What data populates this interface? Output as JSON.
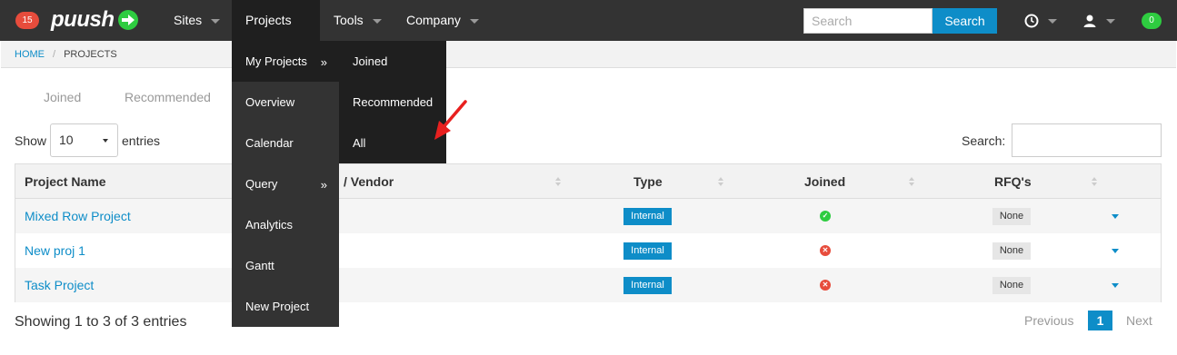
{
  "topbar": {
    "notification_count": "15",
    "logo_text": "puush",
    "nav": [
      {
        "label": "Sites"
      },
      {
        "label": "Projects"
      },
      {
        "label": "Tools"
      },
      {
        "label": "Company"
      }
    ],
    "search_placeholder": "Search",
    "search_button": "Search",
    "message_count": "0"
  },
  "breadcrumb": {
    "home": "HOME",
    "separator": "/",
    "current": "PROJECTS"
  },
  "tabs": [
    {
      "label": "Joined"
    },
    {
      "label": "Recommended"
    }
  ],
  "table_controls": {
    "show_label": "Show",
    "page_size": "10",
    "entries_label": "entries",
    "search_label": "Search:"
  },
  "table": {
    "headers": [
      "Project Name",
      "/ Vendor",
      "Type",
      "Joined",
      "RFQ's"
    ],
    "rows": [
      {
        "name": "Mixed Row Project",
        "type": "Internal",
        "joined": "yes",
        "rfq": "None"
      },
      {
        "name": "New proj 1",
        "type": "Internal",
        "joined": "no",
        "rfq": "None"
      },
      {
        "name": "Task Project",
        "type": "Internal",
        "joined": "no",
        "rfq": "None"
      }
    ]
  },
  "footer": {
    "info": "Showing 1 to 3 of 3 entries",
    "prev": "Previous",
    "page": "1",
    "next": "Next"
  },
  "projects_menu": {
    "items": [
      {
        "label": "My Projects",
        "has_sub": true
      },
      {
        "label": "Overview"
      },
      {
        "label": "Calendar"
      },
      {
        "label": "Query",
        "has_sub": true
      },
      {
        "label": "Analytics"
      },
      {
        "label": "Gantt"
      },
      {
        "label": "New Project"
      }
    ],
    "submenu_marker": "»",
    "my_projects_submenu": [
      {
        "label": "Joined"
      },
      {
        "label": "Recommended"
      },
      {
        "label": "All"
      }
    ]
  },
  "colors": {
    "accent": "#0e8dc8",
    "topbar": "#333333",
    "success": "#2ecc40",
    "danger": "#e74c3c"
  }
}
